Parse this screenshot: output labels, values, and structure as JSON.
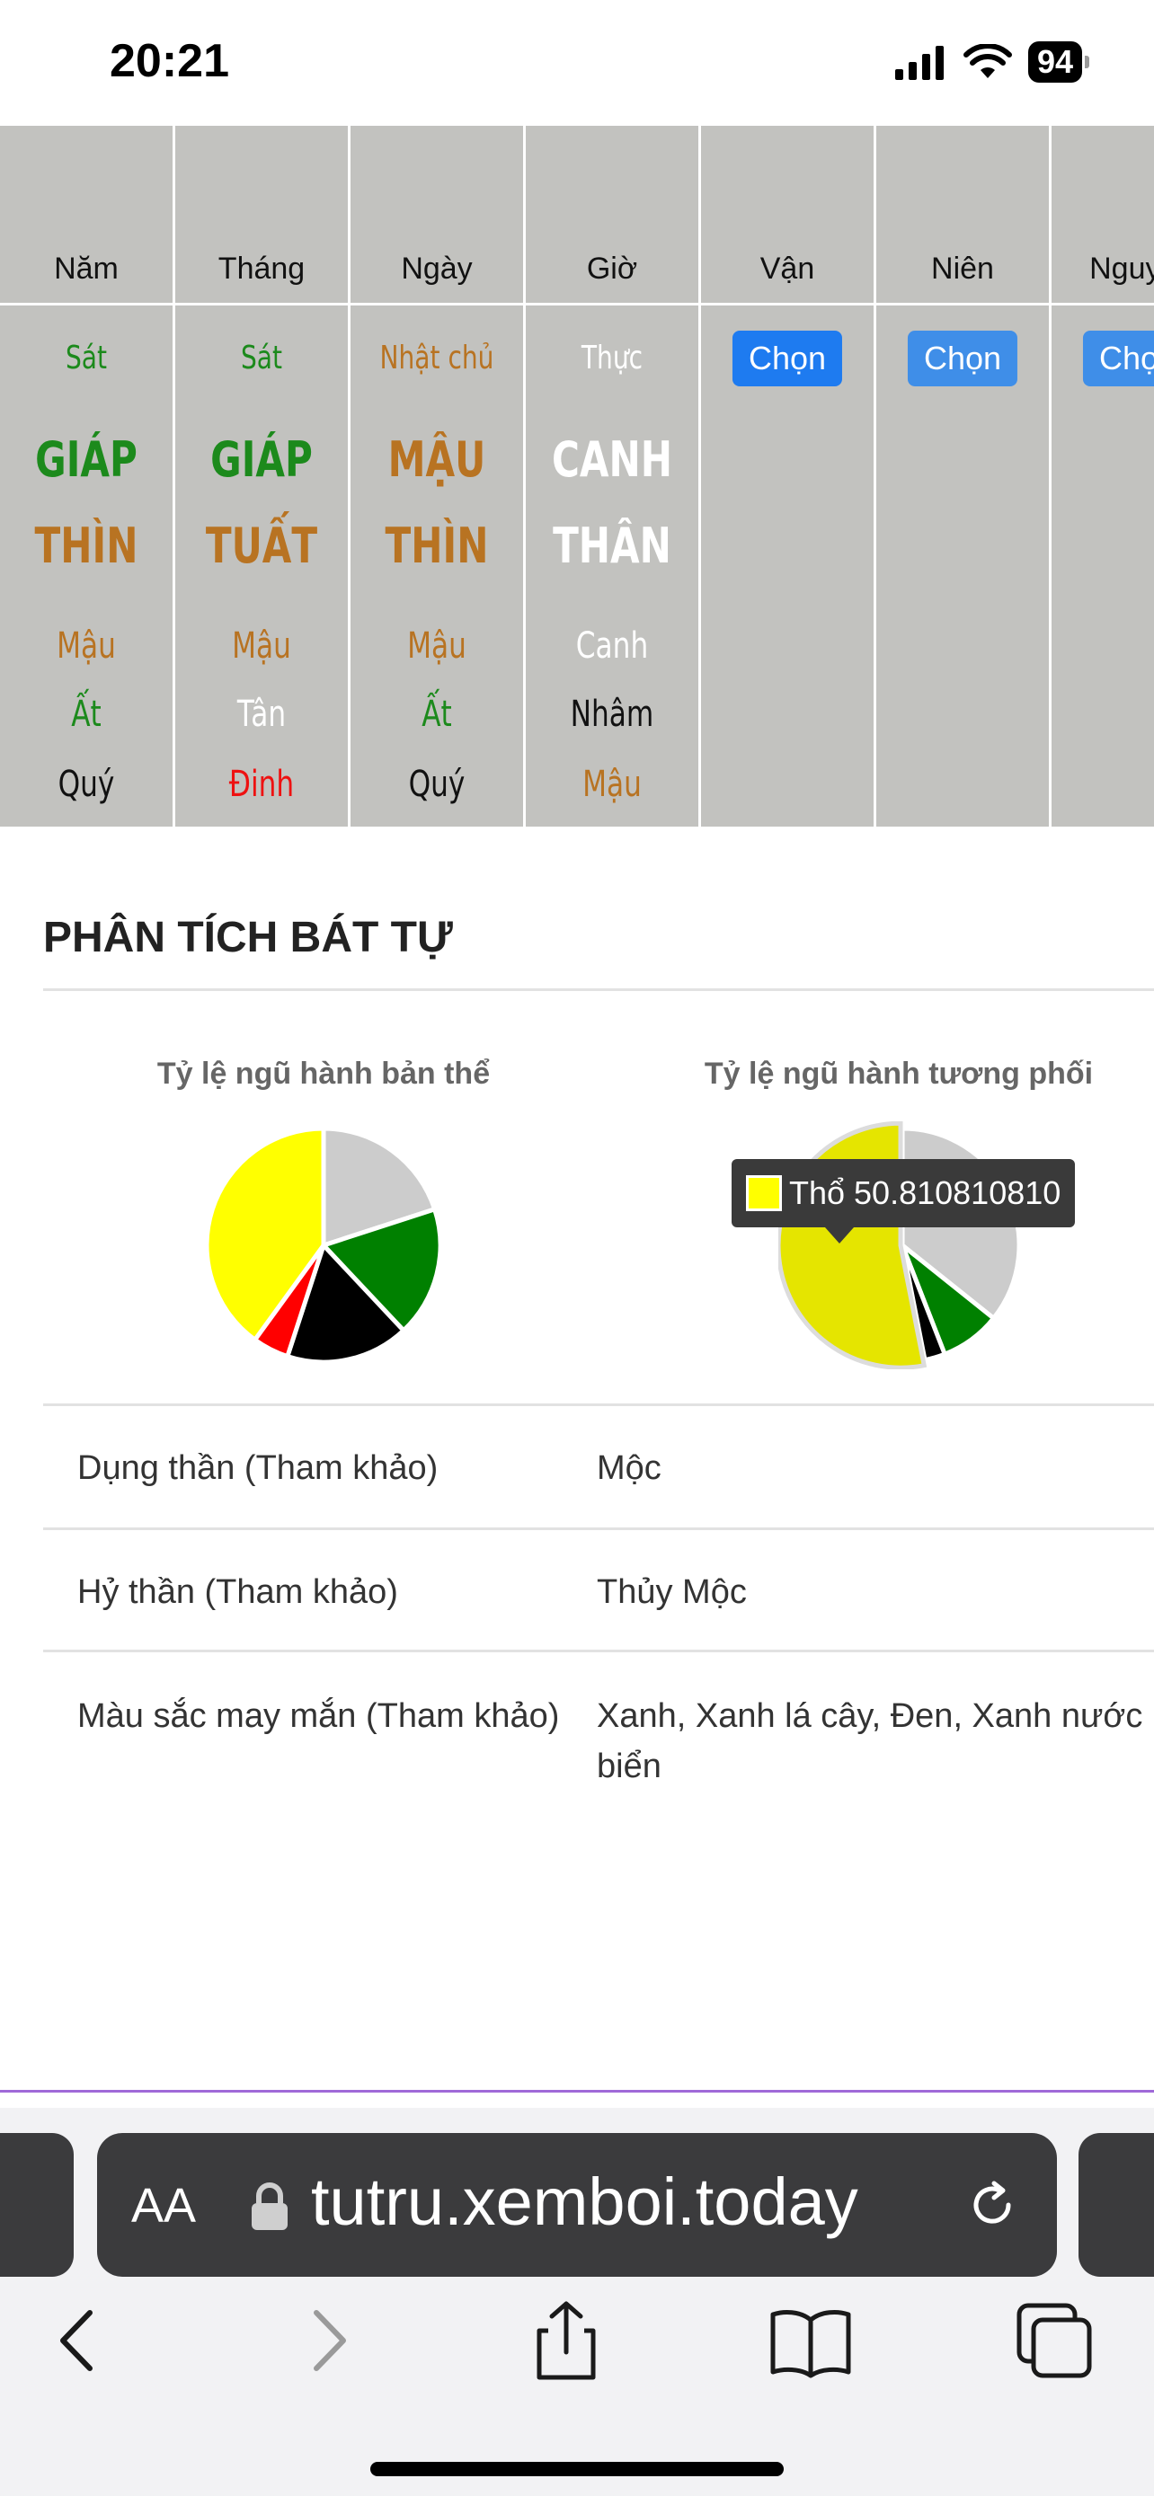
{
  "status": {
    "time": "20:21",
    "battery": "94"
  },
  "pillars": [
    {
      "header": "Năm",
      "star": "Sát",
      "star_color": "#1c8a1c",
      "stem": "GIÁP",
      "stem_color": "#1c8a1c",
      "branch": "THÌN",
      "branch_color": "#b87322",
      "hidden": [
        {
          "text": "Mậu",
          "color": "#b87322"
        },
        {
          "text": "Ất",
          "color": "#1c8a1c"
        },
        {
          "text": "Quý",
          "color": "#111111"
        }
      ]
    },
    {
      "header": "Tháng",
      "star": "Sát",
      "star_color": "#1c8a1c",
      "stem": "GIÁP",
      "stem_color": "#1c8a1c",
      "branch": "TUẤT",
      "branch_color": "#b87322",
      "hidden": [
        {
          "text": "Mậu",
          "color": "#b87322"
        },
        {
          "text": "Tân",
          "color": "#ffffff"
        },
        {
          "text": "Đinh",
          "color": "#ee1111"
        }
      ]
    },
    {
      "header": "Ngày",
      "star": "Nhật chủ",
      "star_color": "#b87322",
      "stem": "MẬU",
      "stem_color": "#b87322",
      "branch": "THÌN",
      "branch_color": "#b87322",
      "hidden": [
        {
          "text": "Mậu",
          "color": "#b87322"
        },
        {
          "text": "Ất",
          "color": "#1c8a1c"
        },
        {
          "text": "Quý",
          "color": "#111111"
        }
      ]
    },
    {
      "header": "Giờ",
      "star": "Thực",
      "star_color": "#ffffff",
      "stem": "CANH",
      "stem_color": "#ffffff",
      "branch": "THÂN",
      "branch_color": "#ffffff",
      "hidden": [
        {
          "text": "Canh",
          "color": "#ffffff"
        },
        {
          "text": "Nhâm",
          "color": "#111111"
        },
        {
          "text": "Mậu",
          "color": "#b87322"
        }
      ]
    }
  ],
  "choice_columns": [
    {
      "header": "Vận",
      "button": "Chọn"
    },
    {
      "header": "Niên",
      "button": "Chọn"
    },
    {
      "header": "Nguyệt",
      "button": "Chọn"
    }
  ],
  "analysis": {
    "title": "PHÂN TÍCH BÁT TỰ",
    "chart1_title": "Tỷ lệ ngũ hành bản thể",
    "chart2_title": "Tỷ lệ ngũ hành tương phối",
    "tooltip": "Thổ 50.810810810"
  },
  "chart_data": [
    {
      "type": "pie",
      "title": "Tỷ lệ ngũ hành bản thể",
      "slices": [
        {
          "color": "#cccccc",
          "value": 20
        },
        {
          "color": "#008000",
          "value": 18
        },
        {
          "color": "#000000",
          "value": 17
        },
        {
          "color": "#ff0000",
          "value": 5
        },
        {
          "color": "#ffff00",
          "value": 40
        }
      ]
    },
    {
      "type": "pie",
      "title": "Tỷ lệ ngũ hành tương phối",
      "slices": [
        {
          "color": "#cccccc",
          "value": 34.2
        },
        {
          "color": "#008000",
          "value": 8
        },
        {
          "color": "#000000",
          "value": 2.7
        },
        {
          "color": "#e5e500",
          "label": "Thổ",
          "value": 50.81081081
        }
      ]
    }
  ],
  "info": [
    {
      "label": "Dụng thần (Tham khảo)",
      "value": "Mộc"
    },
    {
      "label": "Hỷ thần (Tham khảo)",
      "value": "Thủy  Mộc"
    },
    {
      "label": "Màu sắc may mắn (Tham khảo)",
      "value": "Xanh, Xanh lá cây, Đen, Xanh nước biển"
    }
  ],
  "browser": {
    "aa": "AA",
    "url": "tutru.xemboi.today"
  }
}
